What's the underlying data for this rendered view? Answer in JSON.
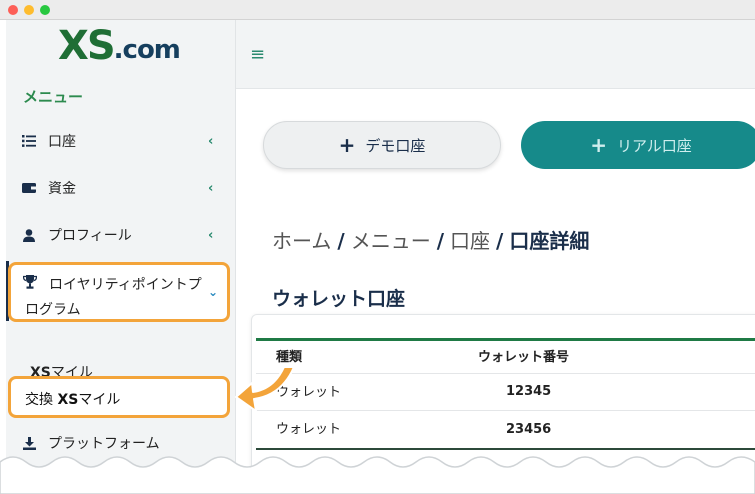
{
  "window": {
    "buttons": [
      "close",
      "minimize",
      "maximize"
    ]
  },
  "logo": {
    "text_main": "XS",
    "text_suffix": ".com"
  },
  "sidebar": {
    "menu_heading": "メニュー",
    "items": [
      {
        "label": "口座",
        "icon": "list-icon"
      },
      {
        "label": "資金",
        "icon": "wallet-icon"
      },
      {
        "label": "プロフィール",
        "icon": "user-icon"
      }
    ],
    "loyalty": {
      "label": "ロイヤリティポイントプログラム",
      "icon": "trophy-icon"
    },
    "submenu": {
      "xs_miles_prefix": "XS",
      "xs_miles_suffix": "マイル",
      "exchange_prefix": "交換 ",
      "exchange_bold": "XS",
      "exchange_suffix": "マイル"
    },
    "platform": {
      "label": "プラットフォーム",
      "icon": "download-icon"
    }
  },
  "header": {
    "hamburger": "≡"
  },
  "buttons": {
    "demo": "デモ口座",
    "real": "リアル口座",
    "plus": "+"
  },
  "breadcrumb": {
    "home": "ホーム",
    "menu": "メニュー",
    "account": "口座",
    "current": "口座詳細",
    "sep": "/"
  },
  "wallet": {
    "title": "ウォレット口座",
    "columns": [
      "種類",
      "ウォレット番号"
    ],
    "rows": [
      {
        "type": "ウォレット",
        "number": "12345"
      },
      {
        "type": "ウォレット",
        "number": "23456"
      }
    ]
  },
  "colors": {
    "accent_green": "#1f7a45",
    "teal": "#168a8a",
    "highlight": "#f3a43a",
    "navy": "#1a2e4a"
  }
}
